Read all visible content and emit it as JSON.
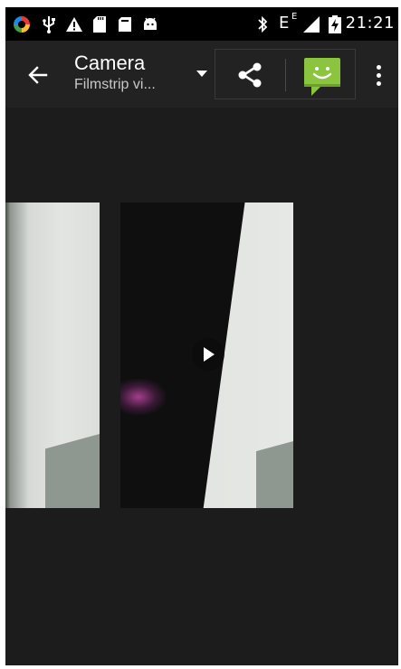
{
  "status_bar": {
    "time": "21:21",
    "network_type": "E",
    "network_sup": "E",
    "icons": [
      "sync-app-icon",
      "usb-icon",
      "warning-icon",
      "sd-card-icon",
      "sim-card-icon",
      "android-debug-icon",
      "bluetooth-icon",
      "signal-icon",
      "battery-charging-icon"
    ]
  },
  "action_bar": {
    "title": "Camera",
    "subtitle": "Filmstrip vi...",
    "back_icon": "arrow-left-icon",
    "share_icon": "share-icon",
    "message_icon": "messaging-app-icon",
    "overflow_icon": "more-vert-icon"
  },
  "filmstrip": {
    "items": [
      {
        "kind": "photo"
      },
      {
        "kind": "video",
        "overlay_icon": "play-icon"
      }
    ]
  },
  "colors": {
    "background": "#1c1c1c",
    "status_bar": "#000000",
    "action_bar": "#222222",
    "message_icon_green": "#8bc43f"
  }
}
